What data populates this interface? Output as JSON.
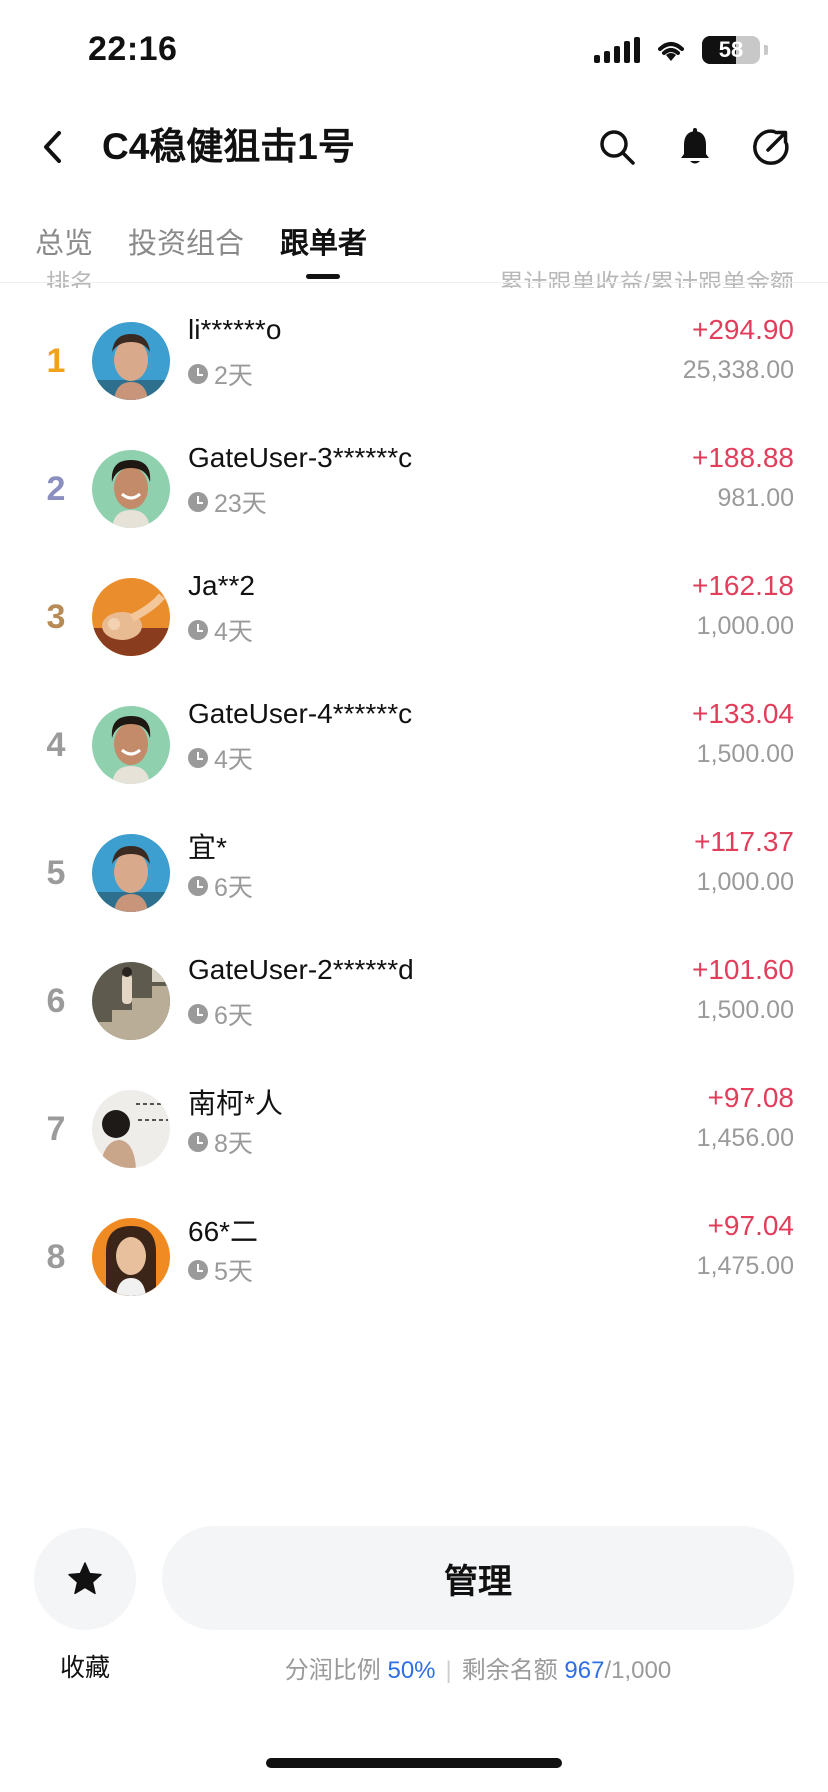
{
  "status_bar": {
    "time": "22:16",
    "battery": "58"
  },
  "header": {
    "title": "C4稳健狙击1号"
  },
  "tabs": [
    {
      "label": "总览"
    },
    {
      "label": "投资组合"
    },
    {
      "label": "跟单者",
      "active": true
    }
  ],
  "columns": {
    "left": "排名",
    "right": "累计跟单收益/累计跟单金额"
  },
  "followers": [
    {
      "rank": "1",
      "name": "li******o",
      "days": "2天",
      "profit": "+294.90",
      "amount": "25,338.00",
      "rank_color": "#f0a21b",
      "avatar": "man-blue"
    },
    {
      "rank": "2",
      "name": "GateUser-3******c",
      "days": "23天",
      "profit": "+188.88",
      "amount": "981.00",
      "rank_color": "#8a8fbf",
      "avatar": "man-green"
    },
    {
      "rank": "3",
      "name": "Ja**2",
      "days": "4天",
      "profit": "+162.18",
      "amount": "1,000.00",
      "rank_color": "#b78b55",
      "avatar": "hand-orange"
    },
    {
      "rank": "4",
      "name": "GateUser-4******c",
      "days": "4天",
      "profit": "+133.04",
      "amount": "1,500.00",
      "rank_color": "#9b9b9b",
      "avatar": "man-green"
    },
    {
      "rank": "5",
      "name": "宜*",
      "days": "6天",
      "profit": "+117.37",
      "amount": "1,000.00",
      "rank_color": "#9b9b9b",
      "avatar": "man-blue"
    },
    {
      "rank": "6",
      "name": "GateUser-2******d",
      "days": "6天",
      "profit": "+101.60",
      "amount": "1,500.00",
      "rank_color": "#9b9b9b",
      "avatar": "stairs"
    },
    {
      "rank": "7",
      "name": "南柯*人",
      "days": "8天",
      "profit": "+97.08",
      "amount": "1,456.00",
      "rank_color": "#9b9b9b",
      "avatar": "woman-sketch"
    },
    {
      "rank": "8",
      "name": "66*二",
      "days": "5天",
      "profit": "+97.04",
      "amount": "1,475.00",
      "rank_color": "#9b9b9b",
      "avatar": "woman-orange"
    }
  ],
  "bottom": {
    "favorite_label": "收藏",
    "manage_label": "管理",
    "profit_share_label": "分润比例",
    "profit_share_value": "50%",
    "separator": "|",
    "remaining_label": "剩余名额",
    "remaining_value": "967",
    "remaining_total": "/1,000"
  },
  "colors": {
    "profit": "#e23d5a",
    "highlight": "#2f6fe4",
    "gold": "#f0a21b",
    "silver": "#8a8fbf",
    "bronze": "#b78b55"
  }
}
